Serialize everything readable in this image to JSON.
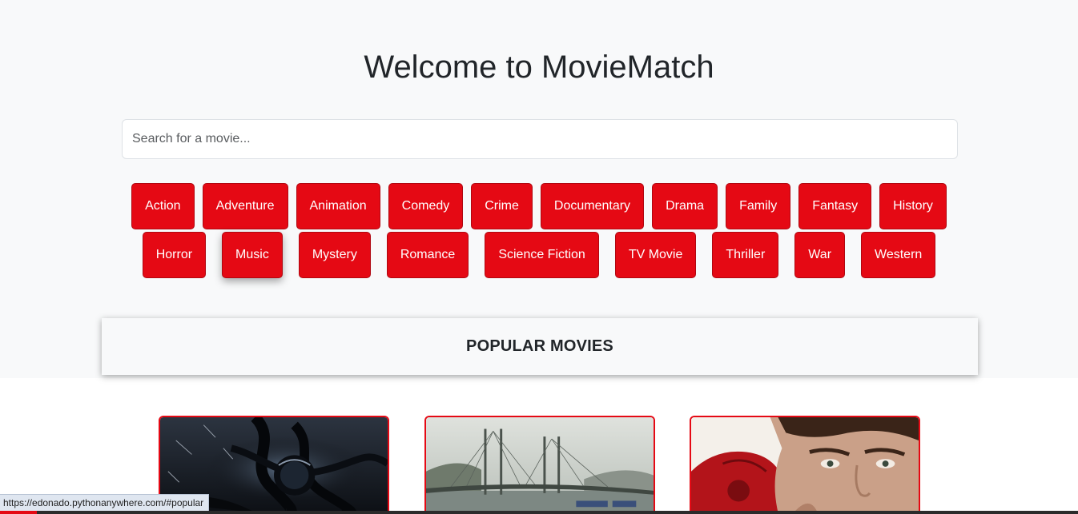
{
  "header": {
    "title": "Welcome to MovieMatch"
  },
  "search": {
    "placeholder": "Search for a movie...",
    "value": ""
  },
  "genres": {
    "row1": [
      "Action",
      "Adventure",
      "Animation",
      "Comedy",
      "Crime",
      "Documentary",
      "Drama",
      "Family",
      "Fantasy",
      "History"
    ],
    "row2": [
      "Horror",
      "Music",
      "Mystery",
      "Romance",
      "Science Fiction",
      "TV Movie",
      "Thriller",
      "War",
      "Western"
    ],
    "hovered": "Music"
  },
  "popular": {
    "title": "POPULAR MOVIES"
  },
  "status_bar": {
    "url": "https://edonado.pythonanywhere.com/#popular"
  },
  "colors": {
    "accent": "#e50914",
    "hero_background": "#f8f9fa"
  }
}
